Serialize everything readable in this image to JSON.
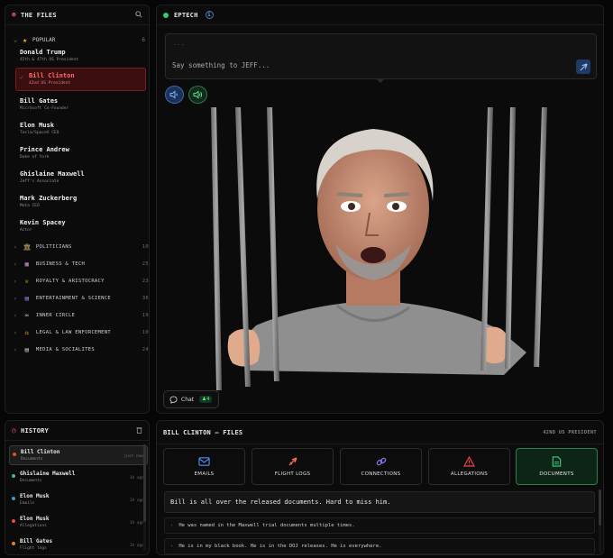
{
  "sidebar": {
    "title": "THE FILES",
    "popular": {
      "label": "POPULAR",
      "count": "6"
    },
    "people": [
      {
        "name": "Donald Trump",
        "sub": "45th & 47th US President"
      },
      {
        "name": "Bill Clinton",
        "sub": "42nd US President",
        "selected": true
      },
      {
        "name": "Bill Gates",
        "sub": "Microsoft Co-Founder"
      },
      {
        "name": "Elon Musk",
        "sub": "Tesla/SpaceX CEO"
      },
      {
        "name": "Prince Andrew",
        "sub": "Duke of York"
      },
      {
        "name": "Ghislaine Maxwell",
        "sub": "Jeff's Associate"
      },
      {
        "name": "Mark Zuckerberg",
        "sub": "Meta CEO"
      },
      {
        "name": "Kevin Spacey",
        "sub": "Actor"
      }
    ],
    "categories": [
      {
        "label": "POLITICIANS",
        "count": "10",
        "icon": "classical-building-icon"
      },
      {
        "label": "BUSINESS & TECH",
        "count": "25",
        "icon": "office-building-icon"
      },
      {
        "label": "ROYALTY & ARISTOCRACY",
        "count": "23",
        "icon": "crown-icon"
      },
      {
        "label": "ENTERTAINMENT & SCIENCE",
        "count": "36",
        "icon": "film-icon"
      },
      {
        "label": "INNER CIRCLE",
        "count": "19",
        "icon": "link-icon"
      },
      {
        "label": "LEGAL & LAW ENFORCEMENT",
        "count": "10",
        "icon": "scales-icon"
      },
      {
        "label": "MEDIA & SOCIALITES",
        "count": "24",
        "icon": "newspaper-icon"
      }
    ]
  },
  "history": {
    "title": "HISTORY",
    "items": [
      {
        "name": "Bill Clinton",
        "sub": "Documents",
        "time": "just now",
        "color": "#e74c3c"
      },
      {
        "name": "Ghislaine Maxwell",
        "sub": "Documents",
        "time": "1h ago",
        "color": "#2ecc71"
      },
      {
        "name": "Elon Musk",
        "sub": "Emails",
        "time": "1h ago",
        "color": "#3498db"
      },
      {
        "name": "Elon Musk",
        "sub": "Allegations",
        "time": "1h ago",
        "color": "#e74c3c"
      },
      {
        "name": "Bill Gates",
        "sub": "Flight logs",
        "time": "1h ago",
        "color": "#e67e22"
      }
    ]
  },
  "main": {
    "title": "EPTECH",
    "status_color": "#2ecc71",
    "chat_dots": "...",
    "chat_placeholder": "Say something to JEFF...",
    "chat_label": "Chat",
    "chat_users": "4"
  },
  "files": {
    "title": "BILL CLINTON — FILES",
    "subtitle": "42ND US PRESIDENT",
    "tabs": [
      {
        "label": "EMAILS",
        "icon": "mail-icon",
        "color": "#4f8ff7"
      },
      {
        "label": "FLIGHT LOGS",
        "icon": "plane-icon",
        "color": "#ef6c4a"
      },
      {
        "label": "CONNECTIONS",
        "icon": "link-icon",
        "color": "#8b7cf6"
      },
      {
        "label": "ALLEGATIONS",
        "icon": "warning-icon",
        "color": "#ef4444"
      },
      {
        "label": "DOCUMENTS",
        "icon": "document-icon",
        "color": "#34d27a",
        "active": true
      }
    ],
    "quote": "Bill is all over the released documents. Hard to miss him.",
    "facts": [
      "He was named in the Maxwell trial documents multiple times.",
      "He is in my black book. He is in the DOJ releases. He is everywhere."
    ]
  }
}
